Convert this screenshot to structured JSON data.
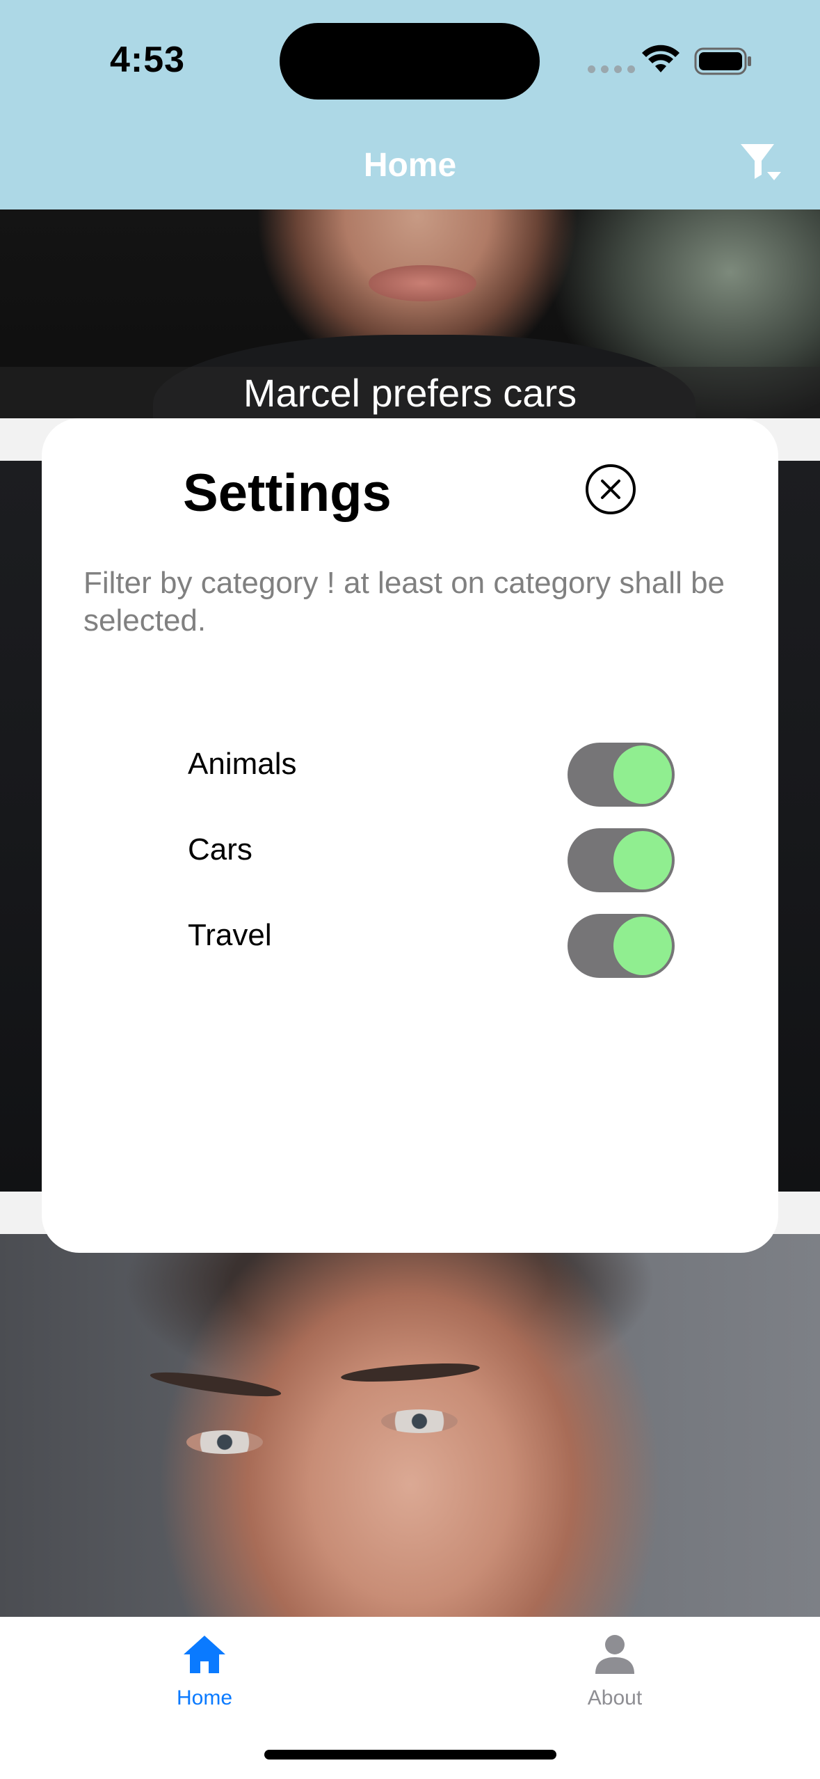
{
  "status_bar": {
    "time": "4:53"
  },
  "header": {
    "title": "Home",
    "filter_icon": "filter-dropdown-icon",
    "background_color": "#add8e6"
  },
  "feed": {
    "cards": [
      {
        "caption": "Marcel prefers cars"
      },
      {
        "caption": ""
      },
      {
        "caption": ""
      }
    ]
  },
  "settings_modal": {
    "title": "Settings",
    "close_icon": "close-circle-icon",
    "description": "Filter by category ! at least on category shall be selected.",
    "switches": [
      {
        "label": "Animals",
        "on": true
      },
      {
        "label": "Cars",
        "on": true
      },
      {
        "label": "Travel",
        "on": true
      }
    ],
    "switch_track_color": "#767577",
    "switch_thumb_color": "#90ee90"
  },
  "tab_bar": {
    "tabs": [
      {
        "label": "Home",
        "icon": "home-icon",
        "active": true,
        "color": "#0a7aff"
      },
      {
        "label": "About",
        "icon": "person-icon",
        "active": false,
        "color": "#8e8e93"
      }
    ]
  }
}
